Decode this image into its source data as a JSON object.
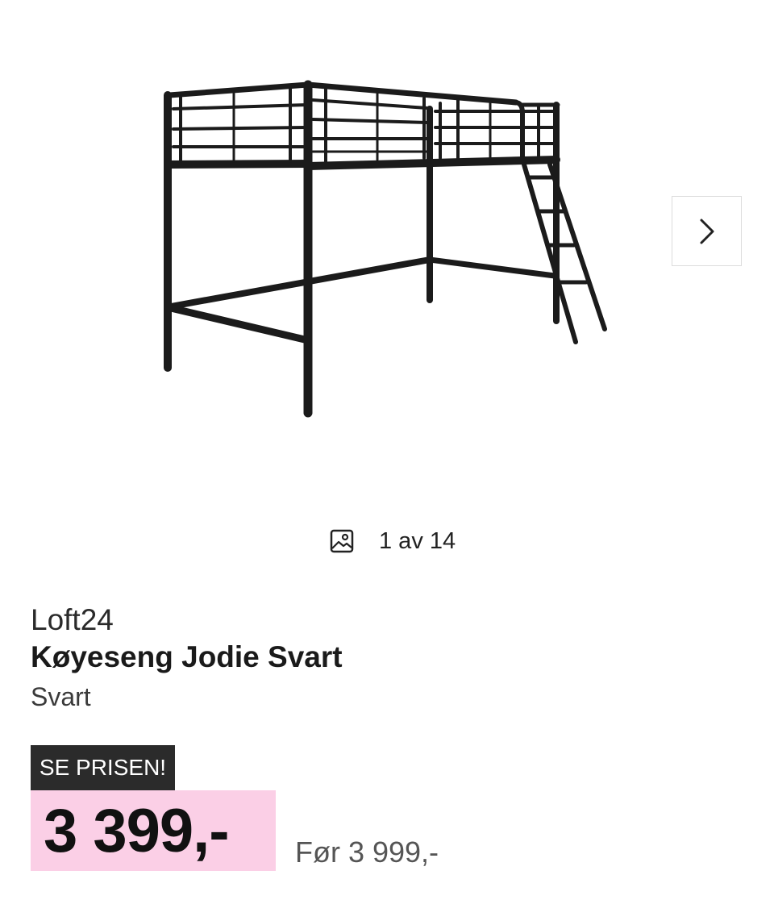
{
  "gallery": {
    "image_alt": "Køyeseng Jodie Svart",
    "counter_text": "1 av 14",
    "icons": {
      "next": "chevron-right-icon",
      "counter": "image-icon"
    }
  },
  "product": {
    "brand": "Loft24",
    "title": "Køyeseng Jodie Svart",
    "color": "Svart"
  },
  "pricing": {
    "badge": "SE PRISEN!",
    "price": "3 399,-",
    "before_price": "Før 3 999,-",
    "price_bg_color": "#fbcfe6",
    "badge_bg_color": "#2b2b2b"
  }
}
